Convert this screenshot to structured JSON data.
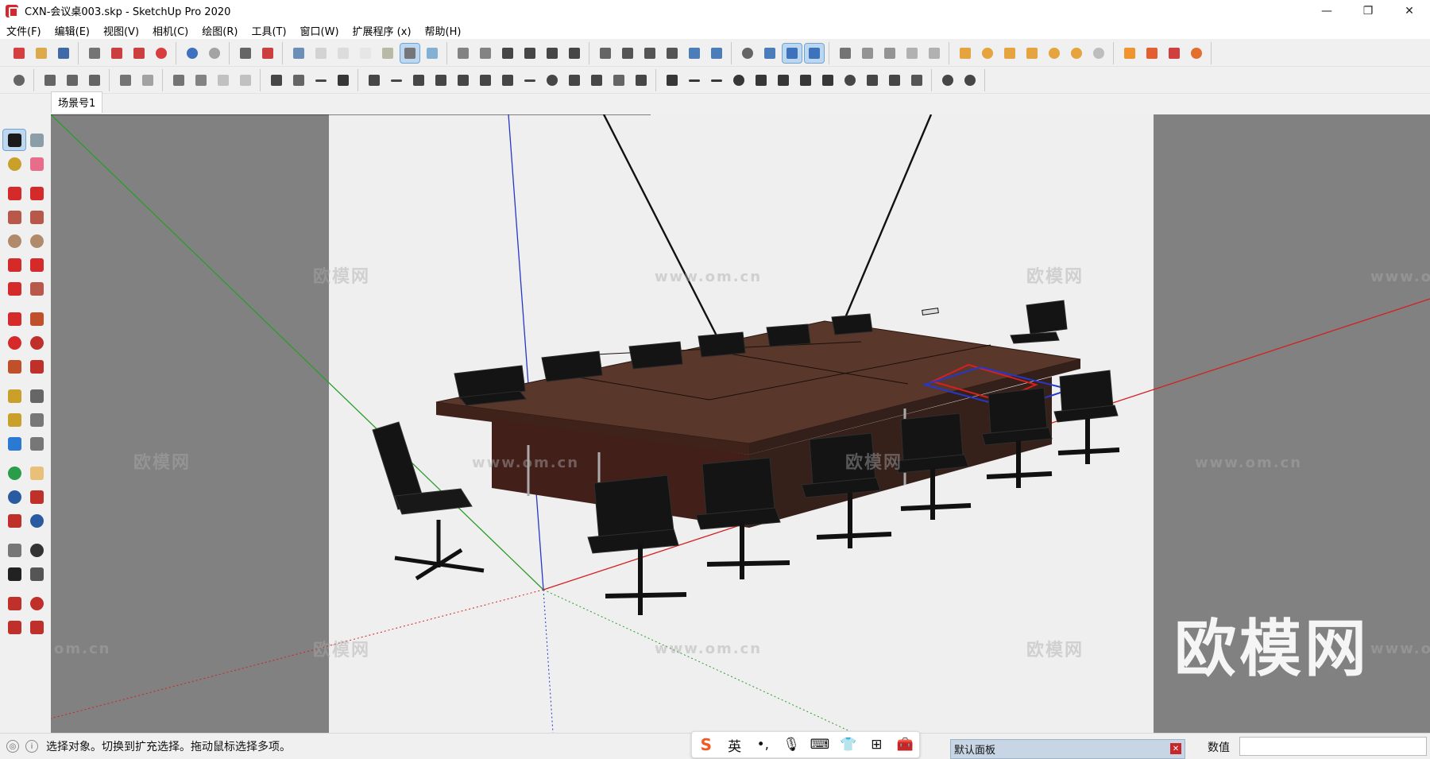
{
  "window": {
    "title": "CXN-会议桌003.skp - SketchUp Pro 2020",
    "controls": {
      "minimize": "—",
      "restore": "❐",
      "close": "✕"
    }
  },
  "menu": [
    "文件(F)",
    "编辑(E)",
    "视图(V)",
    "相机(C)",
    "绘图(R)",
    "工具(T)",
    "窗口(W)",
    "扩展程序 (x)",
    "帮助(H)"
  ],
  "scene_tab": "场景号1",
  "watermarks": {
    "brand": "欧模网",
    "site": "www.om.cn",
    "site_partial": "om.cn",
    "site_cut": "www.o"
  },
  "status": {
    "info_icons": [
      "geo-location-icon",
      "info-icon"
    ],
    "message": "选择对象。切换到扩充选择。拖动鼠标选择多项。"
  },
  "ime": {
    "logo": "S",
    "mode": "英",
    "items": [
      "punctuation-icon",
      "microphone-icon",
      "keyboard-icon",
      "skin-icon",
      "apps-grid-icon",
      "toolbox-icon"
    ]
  },
  "panel": {
    "title": "默认面板",
    "close": "✕"
  },
  "measurements": {
    "label": "数值",
    "value": ""
  },
  "colors": {
    "axis_red": "#d42020",
    "axis_green": "#2a9d2a",
    "axis_blue": "#2438c9",
    "table_wood": "#4a2a20",
    "chair_black": "#151515",
    "viewport_bg": "#818181",
    "frame_bg": "#efefef",
    "accent_active": "#bcd7ef"
  },
  "model": {
    "description_labels": [],
    "chairs": 14
  }
}
